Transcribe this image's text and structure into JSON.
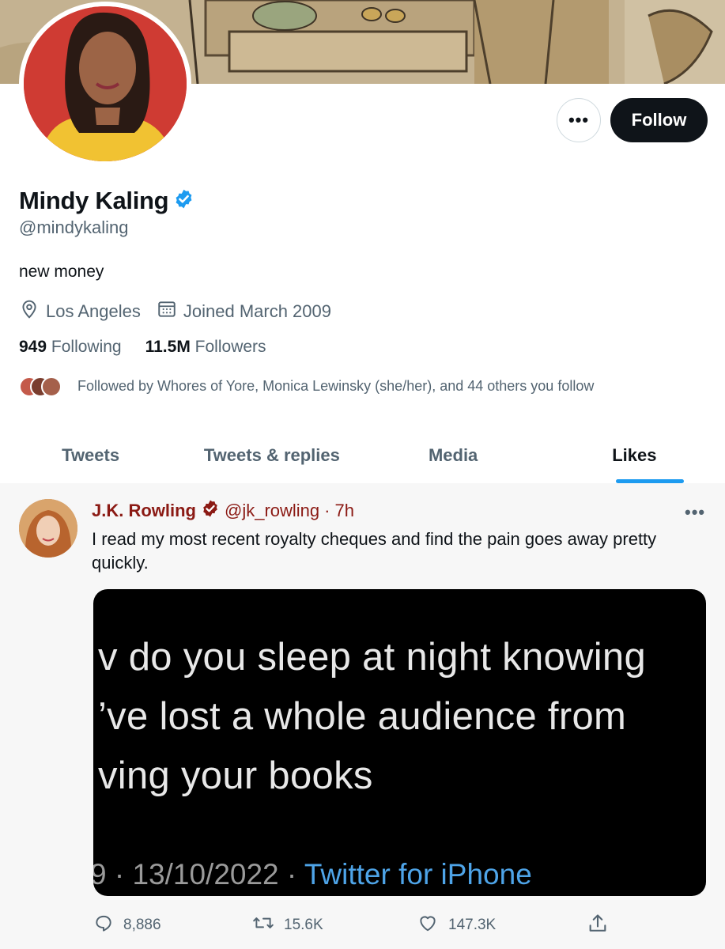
{
  "profile": {
    "name": "Mindy Kaling",
    "handle": "@mindykaling",
    "bio": "new money",
    "location": "Los Angeles",
    "joined": "Joined March 2009",
    "following_count": "949",
    "following_label": "Following",
    "followers_count": "11.5M",
    "followers_label": "Followers",
    "followed_by": "Followed by Whores of Yore, Monica Lewinsky (she/her), and 44 others you follow",
    "verified": true
  },
  "buttons": {
    "more": "•••",
    "follow": "Follow"
  },
  "tabs": [
    {
      "label": "Tweets",
      "active": false
    },
    {
      "label": "Tweets & replies",
      "active": false
    },
    {
      "label": "Media",
      "active": false
    },
    {
      "label": "Likes",
      "active": true
    }
  ],
  "tweet": {
    "author": "J.K. Rowling",
    "handle": "@jk_rowling",
    "separator": "·",
    "time": "7h",
    "more": "•••",
    "text": "I read my most recent royalty cheques and find the pain goes away pretty quickly.",
    "media": {
      "line1": "v do you sleep at night knowing",
      "line2": "’ve lost a whole audience from",
      "line3": "ving your books",
      "footer_meta": "9 · 13/10/2022 · ",
      "footer_source": "Twitter for iPhone"
    },
    "replies": "8,886",
    "retweets": "15.6K",
    "likes": "147.3K"
  },
  "colors": {
    "accent": "#1d9bf0",
    "text": "#0f1419",
    "muted": "#536471",
    "author_red": "#8b1a14",
    "follow_bg": "#0f1419"
  },
  "icons": {
    "verified": "verified-badge-icon",
    "location": "location-pin-icon",
    "calendar": "calendar-icon",
    "reply": "reply-icon",
    "retweet": "retweet-icon",
    "like": "heart-icon",
    "share": "share-icon"
  }
}
